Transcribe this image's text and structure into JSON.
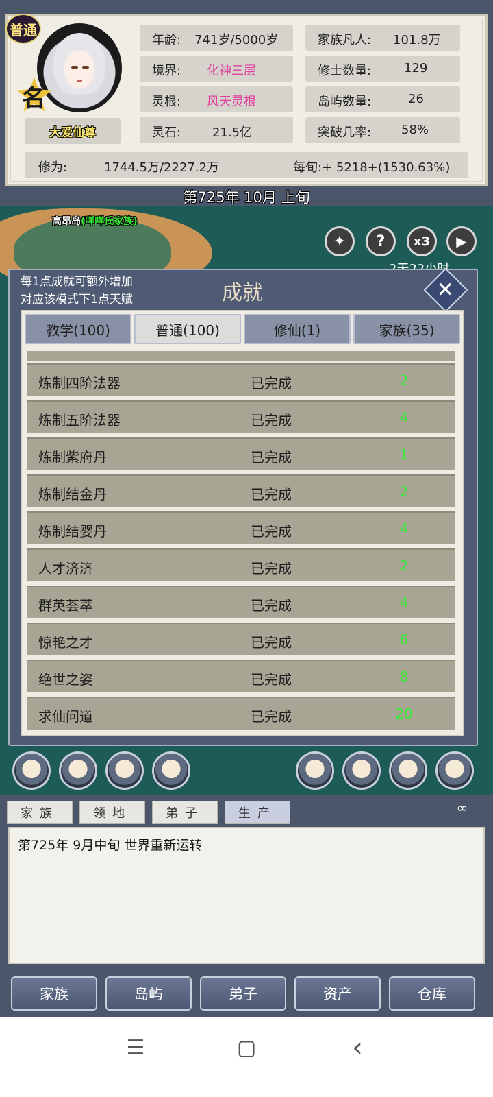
{
  "player": {
    "rank_badge": "普通",
    "name_seal": "名",
    "title": "大爱仙尊"
  },
  "stats": [
    {
      "label": "年龄:",
      "value": "741岁/5000岁"
    },
    {
      "label": "家族凡人:",
      "value": "101.8万"
    },
    {
      "label": "境界:",
      "value": "化神三层"
    },
    {
      "label": "修士数量:",
      "value": "129"
    },
    {
      "label": "灵根:",
      "value": "风天灵根"
    },
    {
      "label": "岛屿数量:",
      "value": "26"
    },
    {
      "label": "灵石:",
      "value": "21.5亿"
    },
    {
      "label": "突破几率:",
      "value": "58%"
    }
  ],
  "cultivation": {
    "label": "修为:",
    "value": "1744.5万/2227.2万",
    "per_period": "每旬:+ 5218+(1530.63%)"
  },
  "date_line": "第725年 10月 上旬",
  "map": {
    "island_name": "高昂岛",
    "island_family": "(咩咩氏家族)",
    "help_icon": "?",
    "speed_label": "x3",
    "play_icon": "▶",
    "timer_partial": "2天22小时"
  },
  "dialog": {
    "hint_line1": "每1点成就可额外增加",
    "hint_line2": "对应该模式下1点天赋",
    "title": "成就",
    "close": "✕",
    "tabs": [
      {
        "label": "教学(100)",
        "active": false
      },
      {
        "label": "普通(100)",
        "active": true
      },
      {
        "label": "修仙(1)",
        "active": false
      },
      {
        "label": "家族(35)",
        "active": false
      }
    ],
    "rows": [
      {
        "name": "炼制四阶法器",
        "status": "已完成",
        "points": "2"
      },
      {
        "name": "炼制五阶法器",
        "status": "已完成",
        "points": "4"
      },
      {
        "name": "炼制紫府丹",
        "status": "已完成",
        "points": "1"
      },
      {
        "name": "炼制结金丹",
        "status": "已完成",
        "points": "2"
      },
      {
        "name": "炼制结婴丹",
        "status": "已完成",
        "points": "4"
      },
      {
        "name": "人才济济",
        "status": "已完成",
        "points": "2"
      },
      {
        "name": "群英荟萃",
        "status": "已完成",
        "points": "4"
      },
      {
        "name": "惊艳之才",
        "status": "已完成",
        "points": "6"
      },
      {
        "name": "绝世之姿",
        "status": "已完成",
        "points": "8"
      },
      {
        "name": "求仙问道",
        "status": "已完成",
        "points": "20"
      }
    ]
  },
  "message_tabs": [
    "家族",
    "领地",
    "弟子",
    "生产"
  ],
  "message_log": "第725年   9月中旬 世界重新运转",
  "bottom_nav": [
    "家族",
    "岛屿",
    "弟子",
    "资产",
    "仓库"
  ],
  "system_nav": {
    "menu": "☰",
    "home": "▢",
    "back": "‹"
  }
}
